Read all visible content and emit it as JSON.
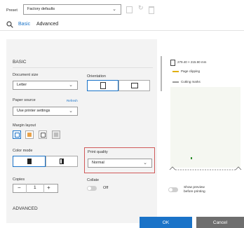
{
  "preset": {
    "label": "Preset",
    "value": "Factory defaults",
    "save_icon": "save-icon",
    "reset_icon": "reset-icon",
    "delete_icon": "trash-icon"
  },
  "tabs": {
    "basic": "Basic",
    "advanced": "Advanced",
    "search_icon": "search-icon"
  },
  "basic_section": {
    "title": "BASIC"
  },
  "document_size": {
    "label": "Document size",
    "value": "Letter"
  },
  "orientation": {
    "label": "Orientation",
    "options": [
      "portrait",
      "landscape"
    ],
    "selected": "portrait"
  },
  "paper_source": {
    "label": "Paper source",
    "refresh": "Refresh",
    "value": "Use printer settings"
  },
  "margin_layout": {
    "label": "Margin layout",
    "options": [
      "margin-standard",
      "margin-clip",
      "margin-oversize",
      "margin-disabled"
    ],
    "selected": 0
  },
  "color_mode": {
    "label": "Color mode",
    "options": [
      "color",
      "grayscale"
    ],
    "selected": 0
  },
  "print_quality": {
    "label": "Print quality",
    "value": "Normal",
    "highlight_color": "#d05a5a"
  },
  "copies": {
    "label": "Copies",
    "value": "1",
    "minus": "−",
    "plus": "+"
  },
  "collate": {
    "label": "Collate",
    "state": "Off"
  },
  "advanced_section": {
    "title": "ADVANCED"
  },
  "preview": {
    "size_text": "279.40 × 215.90 mm",
    "legend": [
      {
        "label": "Page clipping",
        "color": "#e0b010"
      },
      {
        "label": "Cutting marks",
        "color": "#9a9a9a"
      }
    ]
  },
  "show_preview": {
    "label": "Show preview before printing"
  },
  "actions": {
    "ok": "OK",
    "cancel": "Cancel"
  },
  "colors": {
    "accent": "#1a73c8",
    "cancel": "#6e6e6e"
  }
}
